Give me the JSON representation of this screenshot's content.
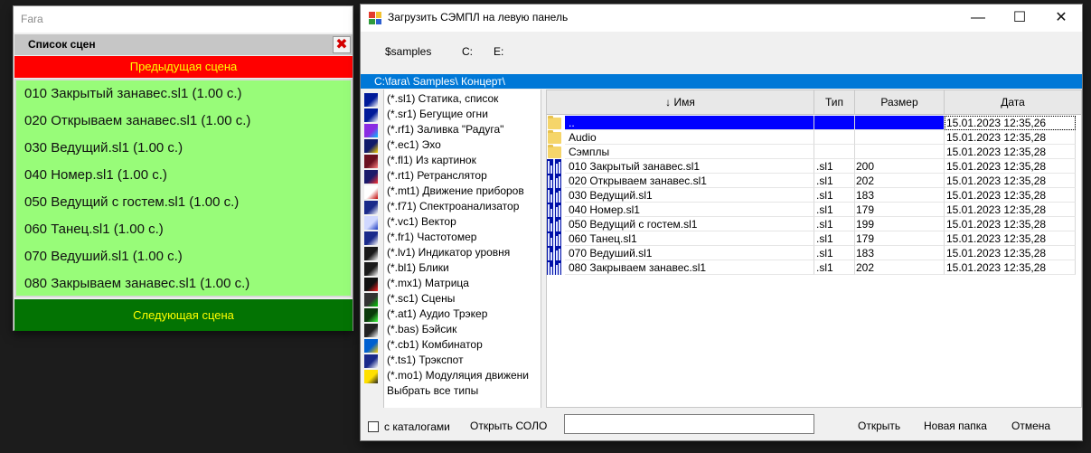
{
  "scene_window": {
    "title": "Fara",
    "header": "Список сцен",
    "prev_label": "Предыдущая сцена",
    "next_label": "Следующая сцена",
    "scenes": [
      "010 Закрытый занавес.sl1 (1.00 с.)",
      "020 Открываем занавес.sl1 (1.00 с.)",
      "030 Ведущий.sl1 (1.00 с.)",
      "040 Номер.sl1 (1.00 с.)",
      "050 Ведущий с гостем.sl1 (1.00 с.)",
      "060 Танец.sl1 (1.00 с.)",
      "070 Ведуший.sl1 (1.00 с.)",
      "080 Закрываем занавес.sl1 (1.00 с.)"
    ]
  },
  "dialog": {
    "title": "Загрузить СЭМПЛ на левую панель",
    "window_buttons": {
      "minimize": "—",
      "maximize": "☐",
      "close": "✕"
    },
    "drives": [
      "$samples",
      "C:",
      "E:"
    ],
    "path": "C:\\fara\\ Samples\\ Концерт\\",
    "types": [
      "(*.sl1) Статика, список",
      "(*.sr1) Бегущие огни",
      "(*.rf1) Заливка \"Радуга\"",
      "(*.ec1) Эхо",
      "(*.fl1) Из картинок",
      "(*.rt1) Ретранслятор",
      "(*.mt1) Движение приборов",
      "(*.f71) Спектроанализатор",
      "(*.vc1) Вектор",
      "(*.fr1) Частотомер",
      "(*.lv1) Индикатор уровня",
      "(*.bl1) Блики",
      "(*.mx1) Матрица",
      "(*.sc1) Сцены",
      "(*.at1) Аудио Трэкер",
      "(*.bas) Бэйсик",
      "(*.cb1) Комбинатор",
      "(*.ts1) Трэкспот",
      "(*.mo1) Модуляция движени",
      "Выбрать все типы"
    ],
    "columns": {
      "name": "↓ Имя",
      "type": "Тип",
      "size": "Размер",
      "date": "Дата"
    },
    "files": [
      {
        "icon": "folder",
        "name": "..",
        "type": "",
        "size": "",
        "date": "15.01.2023 12:35,26"
      },
      {
        "icon": "folder",
        "name": "Audio",
        "type": "",
        "size": "",
        "date": "15.01.2023 12:35,28"
      },
      {
        "icon": "folder",
        "name": "Сэмплы",
        "type": "",
        "size": "",
        "date": "15.01.2023 12:35,28"
      },
      {
        "icon": "sl1",
        "name": "010 Закрытый занавес.sl1",
        "type": ".sl1",
        "size": "200",
        "date": "15.01.2023 12:35,28"
      },
      {
        "icon": "sl1",
        "name": "020 Открываем занавес.sl1",
        "type": ".sl1",
        "size": "202",
        "date": "15.01.2023 12:35,28"
      },
      {
        "icon": "sl1",
        "name": "030 Ведущий.sl1",
        "type": ".sl1",
        "size": "183",
        "date": "15.01.2023 12:35,28"
      },
      {
        "icon": "sl1",
        "name": "040 Номер.sl1",
        "type": ".sl1",
        "size": "179",
        "date": "15.01.2023 12:35,28"
      },
      {
        "icon": "sl1",
        "name": "050 Ведущий с гостем.sl1",
        "type": ".sl1",
        "size": "199",
        "date": "15.01.2023 12:35,28"
      },
      {
        "icon": "sl1",
        "name": "060 Танец.sl1",
        "type": ".sl1",
        "size": "179",
        "date": "15.01.2023 12:35,28"
      },
      {
        "icon": "sl1",
        "name": "070 Ведуший.sl1",
        "type": ".sl1",
        "size": "183",
        "date": "15.01.2023 12:35,28"
      },
      {
        "icon": "sl1",
        "name": "080 Закрываем занавес.sl1",
        "type": ".sl1",
        "size": "202",
        "date": "15.01.2023 12:35,28"
      }
    ],
    "bottom": {
      "with_dirs_label": "с каталогами",
      "with_dirs_checked": false,
      "open_solo": "Открыть СОЛО",
      "filename_value": "",
      "open": "Открыть",
      "new_folder": "Новая папка",
      "cancel": "Отмена"
    }
  }
}
